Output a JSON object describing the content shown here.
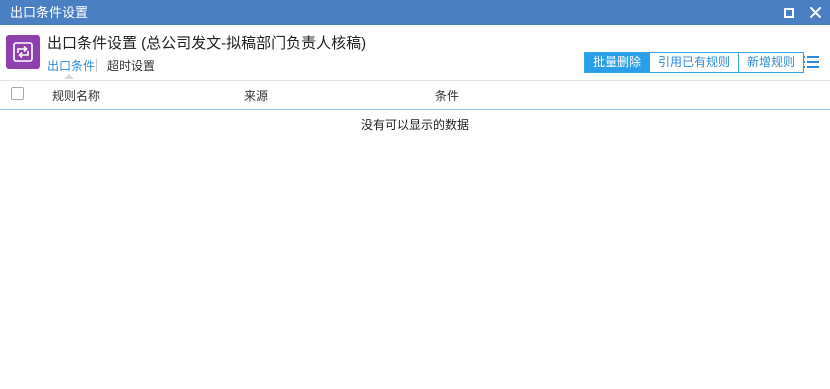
{
  "window": {
    "title": "出口条件设置"
  },
  "icons": {
    "app": "exchange-arrows-icon",
    "maximize": "maximize-icon",
    "close": "close-icon",
    "list": "list-menu-icon"
  },
  "colors": {
    "titlebar": "#4a7fc1",
    "accent": "#2a9ee8",
    "app_icon_bg": "#8e3fb0"
  },
  "header": {
    "title": "出口条件设置 (总公司发文-拟稿部门负责人核稿)"
  },
  "tabs": [
    {
      "label": "出口条件",
      "active": true
    },
    {
      "label": "超时设置",
      "active": false
    }
  ],
  "toolbar": {
    "batch_delete": "批量删除",
    "reference_rule": "引用已有规则",
    "add_rule": "新增规则"
  },
  "table": {
    "columns": [
      "规则名称",
      "来源",
      "条件"
    ],
    "rows": [],
    "empty_text": "没有可以显示的数据"
  }
}
